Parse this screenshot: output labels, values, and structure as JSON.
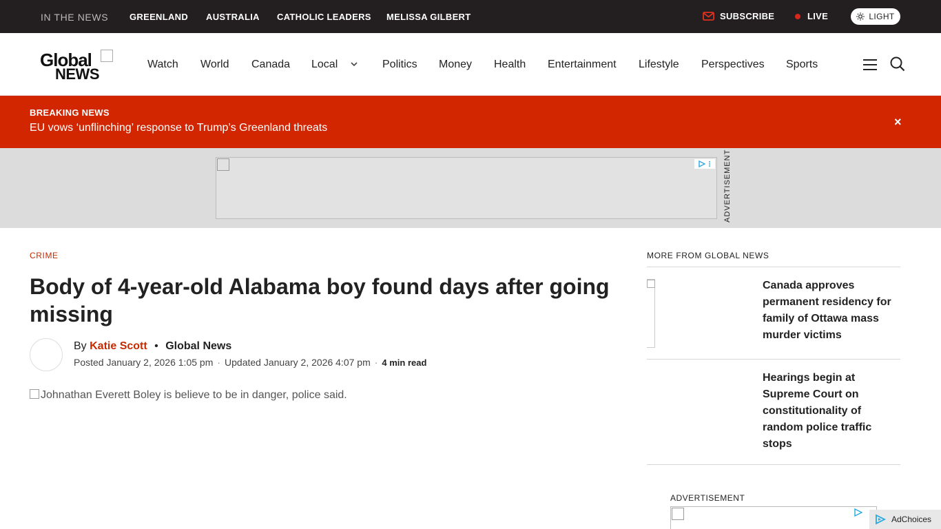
{
  "topbar": {
    "in_the_news": "IN THE NEWS",
    "trending": [
      "GREENLAND",
      "AUSTRALIA",
      "CATHOLIC LEADERS",
      "MELISSA GILBERT"
    ],
    "subscribe": "SUBSCRIBE",
    "live": "LIVE",
    "theme": "LIGHT"
  },
  "logo": {
    "line1": "Global",
    "line2": "NEWS"
  },
  "nav": [
    "Watch",
    "World",
    "Canada",
    "Local",
    "Politics",
    "Money",
    "Health",
    "Entertainment",
    "Lifestyle",
    "Perspectives",
    "Sports"
  ],
  "breaking": {
    "label": "BREAKING NEWS",
    "headline": "EU vows ‘unflinching’ response to Trump’s Greenland threats",
    "close": "×"
  },
  "ad_band": {
    "label": "ADVERTISEMENT"
  },
  "article": {
    "category": "CRIME",
    "headline": "Body of 4-year-old Alabama boy found days after going missing",
    "by": "By",
    "author": "Katie Scott",
    "outlet": "Global News",
    "posted": "Posted January 2, 2026 1:05 pm",
    "updated": "Updated January 2, 2026 4:07 pm",
    "read_time": "4 min read",
    "image_alt": "Johnathan Everett Boley is believe to be in danger, police said."
  },
  "sidebar": {
    "title": "MORE FROM GLOBAL NEWS",
    "stories": [
      {
        "title": "Canada approves permanent residency for family of Ottawa mass murder victims"
      },
      {
        "title": "Hearings begin at Supreme Court on constitutionality of random police traffic stops"
      }
    ],
    "ad_label": "ADVERTISEMENT",
    "adchoices": "AdChoices"
  },
  "colors": {
    "brand_red": "#d22600",
    "topbar_bg": "#231f20",
    "accent_text": "#c52a00"
  }
}
